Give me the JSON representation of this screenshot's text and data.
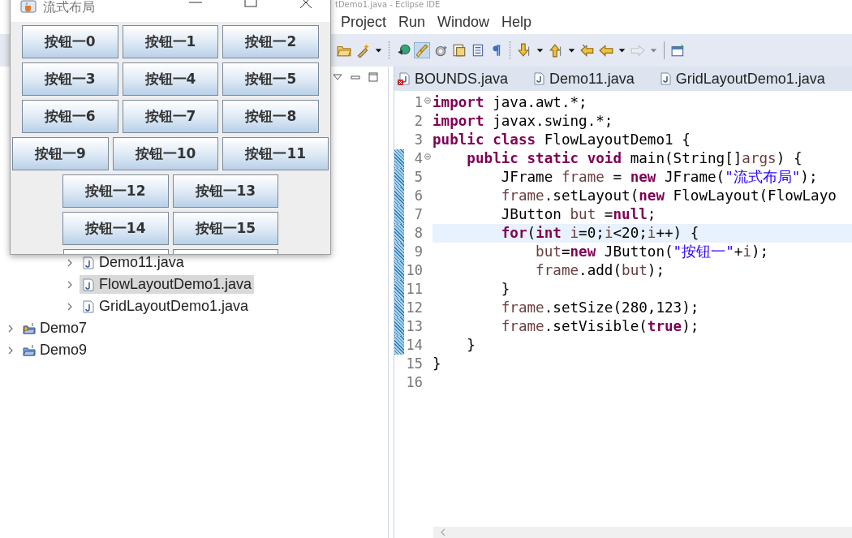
{
  "ide_window": {
    "title": "tDemo1.java - Eclipse IDE"
  },
  "menu": [
    "Project",
    "Run",
    "Window",
    "Help"
  ],
  "toolbar": [
    {
      "kind": "folder",
      "selected": false,
      "disabled": false
    },
    {
      "kind": "wand",
      "selected": false,
      "disabled": false
    },
    {
      "kind": "caret",
      "selected": false,
      "disabled": false
    },
    {
      "kind": "sep"
    },
    {
      "kind": "bubble",
      "selected": false,
      "disabled": false
    },
    {
      "kind": "brush",
      "selected": true,
      "disabled": false
    },
    {
      "kind": "gear",
      "selected": false,
      "disabled": false
    },
    {
      "kind": "doc",
      "selected": false,
      "disabled": false
    },
    {
      "kind": "list",
      "selected": false,
      "disabled": false
    },
    {
      "kind": "pilcrow",
      "selected": false,
      "disabled": false
    },
    {
      "kind": "sep"
    },
    {
      "kind": "down",
      "selected": false,
      "disabled": false
    },
    {
      "kind": "caret",
      "selected": false,
      "disabled": false
    },
    {
      "kind": "up",
      "selected": false,
      "disabled": false
    },
    {
      "kind": "caret",
      "selected": false,
      "disabled": false
    },
    {
      "kind": "backedit",
      "selected": false,
      "disabled": false
    },
    {
      "kind": "back",
      "selected": false,
      "disabled": false
    },
    {
      "kind": "caret",
      "selected": false,
      "disabled": false
    },
    {
      "kind": "forward",
      "selected": false,
      "disabled": true
    },
    {
      "kind": "caret",
      "selected": false,
      "disabled": true
    },
    {
      "kind": "bar"
    },
    {
      "kind": "window",
      "selected": false,
      "disabled": false
    }
  ],
  "explorer": {
    "files": [
      {
        "label": "Demo11.java",
        "selected": false
      },
      {
        "label": "FlowLayoutDemo1.java",
        "selected": true
      },
      {
        "label": "GridLayoutDemo1.java",
        "selected": false
      }
    ],
    "projects": [
      {
        "label": "Demo7",
        "warning": true
      },
      {
        "label": "Demo9",
        "warning": false
      }
    ]
  },
  "editor": {
    "tabs": [
      {
        "label": "BOUNDS.java",
        "error": true
      },
      {
        "label": "Demo11.java",
        "error": false
      },
      {
        "label": "GridLayoutDemo1.java",
        "error": false
      }
    ],
    "lines": [
      {
        "number": "1",
        "fold": true,
        "changed": false,
        "current": false,
        "tokens": [
          {
            "kind": "keyword",
            "text": "import"
          },
          {
            "kind": "plain",
            "text": " java.awt.*;"
          }
        ]
      },
      {
        "number": "2",
        "fold": false,
        "changed": false,
        "current": false,
        "tokens": [
          {
            "kind": "keyword",
            "text": "import"
          },
          {
            "kind": "plain",
            "text": " javax.swing.*;"
          }
        ]
      },
      {
        "number": "3",
        "fold": false,
        "changed": false,
        "current": false,
        "tokens": [
          {
            "kind": "keyword",
            "text": "public class"
          },
          {
            "kind": "plain",
            "text": " FlowLayoutDemo1 {"
          }
        ]
      },
      {
        "number": "4",
        "fold": true,
        "changed": true,
        "current": false,
        "tokens": [
          {
            "kind": "keyword",
            "text": "    public static void"
          },
          {
            "kind": "plain",
            "text": " main(String[]"
          },
          {
            "kind": "variable",
            "text": "args"
          },
          {
            "kind": "plain",
            "text": ") {"
          }
        ]
      },
      {
        "number": "5",
        "fold": false,
        "changed": true,
        "current": false,
        "tokens": [
          {
            "kind": "plain",
            "text": "        JFrame "
          },
          {
            "kind": "variable",
            "text": "frame"
          },
          {
            "kind": "plain",
            "text": " = "
          },
          {
            "kind": "keyword",
            "text": "new"
          },
          {
            "kind": "plain",
            "text": " JFrame("
          },
          {
            "kind": "string",
            "text": "\"流式布局\""
          },
          {
            "kind": "plain",
            "text": ");"
          }
        ]
      },
      {
        "number": "6",
        "fold": false,
        "changed": true,
        "current": false,
        "tokens": [
          {
            "kind": "variable",
            "text": "        frame"
          },
          {
            "kind": "plain",
            "text": ".setLayout("
          },
          {
            "kind": "keyword",
            "text": "new"
          },
          {
            "kind": "plain",
            "text": " FlowLayout(FlowLayo"
          }
        ]
      },
      {
        "number": "7",
        "fold": false,
        "changed": true,
        "current": false,
        "tokens": [
          {
            "kind": "plain",
            "text": "        JButton "
          },
          {
            "kind": "variable",
            "text": "but"
          },
          {
            "kind": "plain",
            "text": " ="
          },
          {
            "kind": "keyword",
            "text": "null"
          },
          {
            "kind": "plain",
            "text": ";"
          }
        ]
      },
      {
        "number": "8",
        "fold": false,
        "changed": true,
        "current": true,
        "tokens": [
          {
            "kind": "keyword",
            "text": "        for"
          },
          {
            "kind": "plain",
            "text": "("
          },
          {
            "kind": "keyword",
            "text": "int"
          },
          {
            "kind": "variable",
            "text": " i"
          },
          {
            "kind": "plain",
            "text": "=0;"
          },
          {
            "kind": "variable",
            "text": "i"
          },
          {
            "kind": "plain",
            "text": "<20;"
          },
          {
            "kind": "variable",
            "text": "i"
          },
          {
            "kind": "plain",
            "text": "++) {"
          }
        ]
      },
      {
        "number": "9",
        "fold": false,
        "changed": true,
        "current": false,
        "tokens": [
          {
            "kind": "variable",
            "text": "            but"
          },
          {
            "kind": "plain",
            "text": "="
          },
          {
            "kind": "keyword",
            "text": "new"
          },
          {
            "kind": "plain",
            "text": " JButton("
          },
          {
            "kind": "string",
            "text": "\"按钮一\""
          },
          {
            "kind": "plain",
            "text": "+"
          },
          {
            "kind": "variable",
            "text": "i"
          },
          {
            "kind": "plain",
            "text": ");"
          }
        ]
      },
      {
        "number": "10",
        "fold": false,
        "changed": true,
        "current": false,
        "tokens": [
          {
            "kind": "variable",
            "text": "            frame"
          },
          {
            "kind": "plain",
            "text": ".add("
          },
          {
            "kind": "variable",
            "text": "but"
          },
          {
            "kind": "plain",
            "text": ");"
          }
        ]
      },
      {
        "number": "11",
        "fold": false,
        "changed": true,
        "current": false,
        "tokens": [
          {
            "kind": "plain",
            "text": "        }"
          }
        ]
      },
      {
        "number": "12",
        "fold": false,
        "changed": true,
        "current": false,
        "tokens": [
          {
            "kind": "variable",
            "text": "        frame"
          },
          {
            "kind": "plain",
            "text": ".setSize(280,123);"
          }
        ]
      },
      {
        "number": "13",
        "fold": false,
        "changed": true,
        "current": false,
        "tokens": [
          {
            "kind": "variable",
            "text": "        frame"
          },
          {
            "kind": "plain",
            "text": ".setVisible("
          },
          {
            "kind": "keyword",
            "text": "true"
          },
          {
            "kind": "plain",
            "text": ");"
          }
        ]
      },
      {
        "number": "14",
        "fold": false,
        "changed": true,
        "current": false,
        "tokens": [
          {
            "kind": "plain",
            "text": "    }"
          }
        ]
      },
      {
        "number": "15",
        "fold": false,
        "changed": false,
        "current": false,
        "tokens": [
          {
            "kind": "plain",
            "text": "}"
          }
        ]
      },
      {
        "number": "16",
        "fold": false,
        "changed": false,
        "current": false
      }
    ]
  },
  "swing_window": {
    "title": "流式布局",
    "buttons": [
      {
        "kind": "button",
        "label": "按钮一0"
      },
      {
        "kind": "button",
        "label": "按钮一1"
      },
      {
        "kind": "button",
        "label": "按钮一2"
      },
      {
        "kind": "button",
        "label": "按钮一3"
      },
      {
        "kind": "button",
        "label": "按钮一4"
      },
      {
        "kind": "button",
        "label": "按钮一5"
      },
      {
        "kind": "button",
        "label": "按钮一6"
      },
      {
        "kind": "button",
        "label": "按钮一7"
      },
      {
        "kind": "button",
        "label": "按钮一8"
      },
      {
        "kind": "button",
        "label": "按钮一9"
      },
      {
        "kind": "button",
        "label": "按钮一10"
      },
      {
        "kind": "button",
        "label": "按钮一11"
      },
      {
        "kind": "button",
        "label": "按钮一12"
      },
      {
        "kind": "button",
        "label": "按钮一13"
      },
      {
        "kind": "button",
        "label": "按钮一14"
      },
      {
        "kind": "button",
        "label": "按钮一15"
      },
      {
        "kind": "cut"
      },
      {
        "kind": "cut"
      }
    ]
  }
}
